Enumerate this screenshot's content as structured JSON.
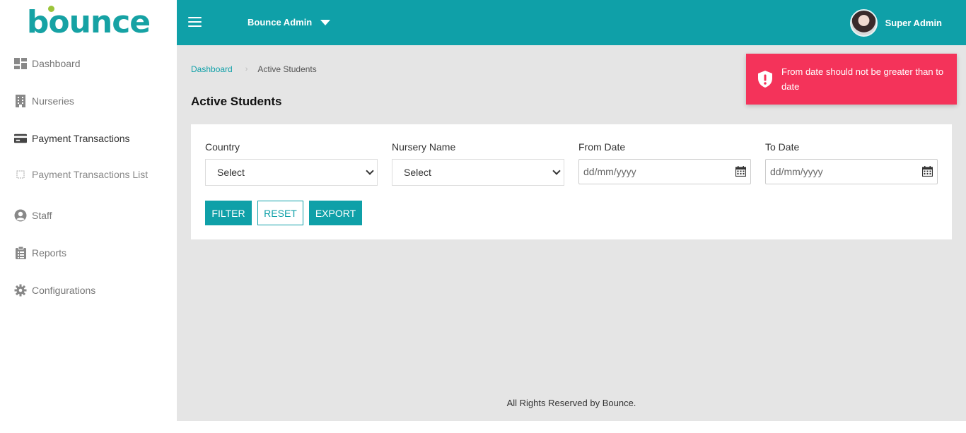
{
  "app": {
    "logo_text": "bounce"
  },
  "sidebar": {
    "items": [
      {
        "label": "Dashboard",
        "icon": "dashboard-icon"
      },
      {
        "label": "Nurseries",
        "icon": "building-icon"
      },
      {
        "label": "Payment Transactions",
        "icon": "credit-card-icon"
      },
      {
        "label": "Payment Transactions List",
        "icon": "square-icon"
      },
      {
        "label": "Staff",
        "icon": "user-circle-icon"
      },
      {
        "label": "Reports",
        "icon": "clipboard-list-icon"
      },
      {
        "label": "Configurations",
        "icon": "gear-icon"
      }
    ]
  },
  "header": {
    "menu_icon": "hamburger-icon",
    "brand_dropdown": "Bounce Admin",
    "user_name": "Super Admin"
  },
  "breadcrumb": {
    "home": "Dashboard",
    "current": "Active Students"
  },
  "page": {
    "title": "Active Students"
  },
  "filters": {
    "country": {
      "label": "Country",
      "value": "Select"
    },
    "nursery": {
      "label": "Nursery Name",
      "value": "Select"
    },
    "from_date": {
      "label": "From Date",
      "placeholder": "dd/mm/yyyy"
    },
    "to_date": {
      "label": "To Date",
      "placeholder": "dd/mm/yyyy"
    }
  },
  "buttons": {
    "filter": "FILTER",
    "reset": "RESET",
    "export": "EXPORT"
  },
  "footer": {
    "text": "All Rights Reserved by Bounce."
  },
  "toast": {
    "message": "From date should not be greater than to date",
    "icon": "shield-exclamation-icon"
  },
  "colors": {
    "primary": "#0fa0a8",
    "error": "#f4335a"
  }
}
